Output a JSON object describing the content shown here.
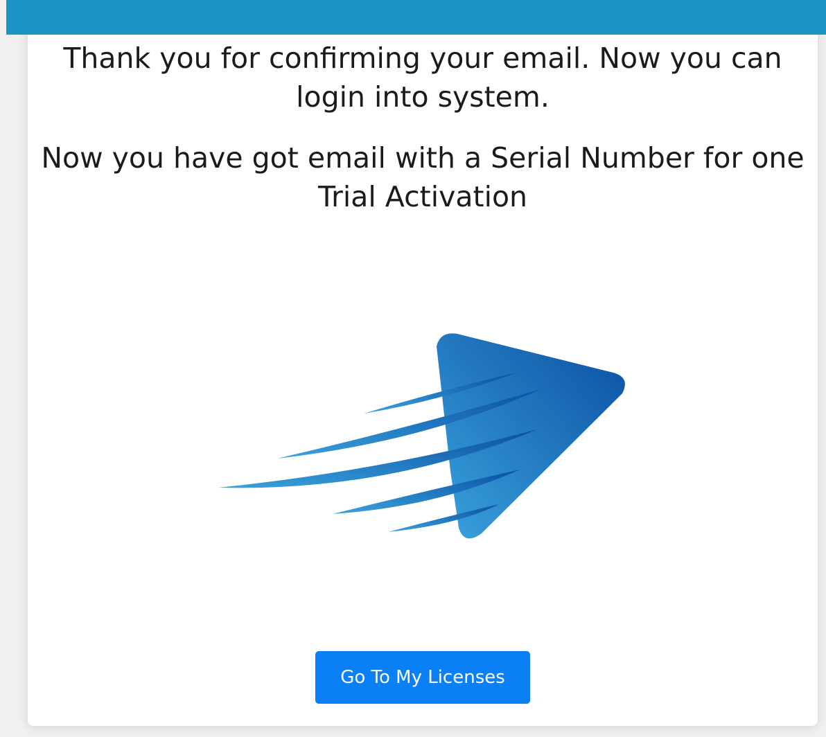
{
  "header": {
    "bar_color": "#1a93c6"
  },
  "message": {
    "confirmation": "Thank you for confirming your email. Now you can login into system.",
    "serial_notice": "Now you have got email with a Serial Number for one Trial Activation"
  },
  "logo": {
    "icon": "speed-arrow-logo-icon",
    "gradient_start": "#3aa3dc",
    "gradient_end": "#0b4fa3"
  },
  "actions": {
    "go_to_licenses_label": "Go To My Licenses",
    "button_color": "#0a7ff6"
  }
}
